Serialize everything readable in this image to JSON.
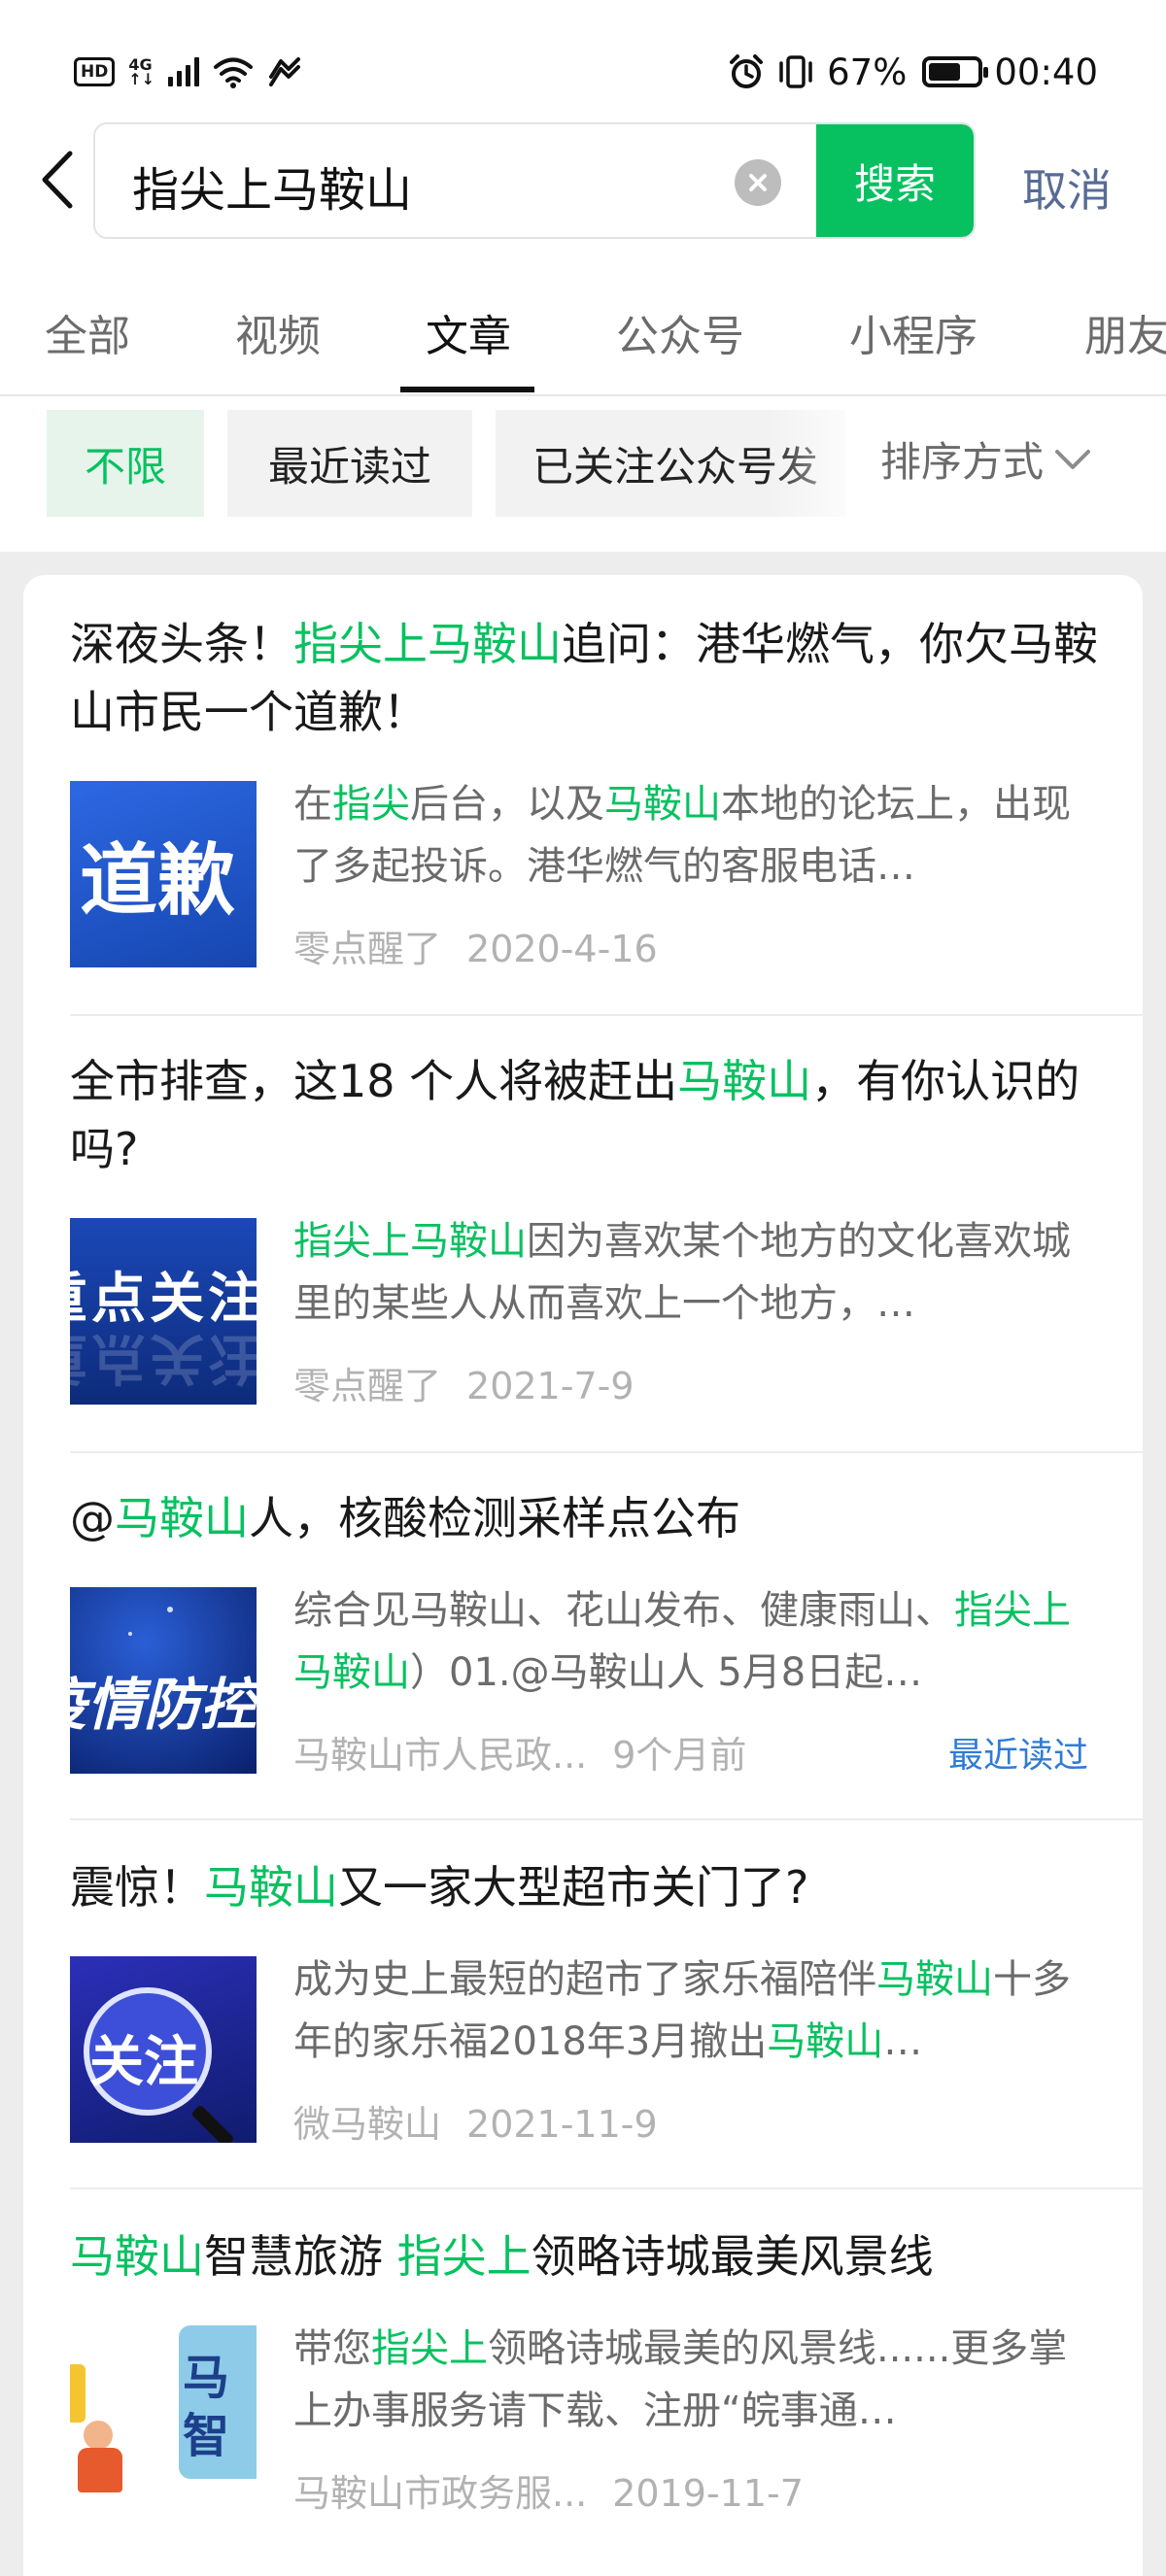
{
  "status_bar": {
    "hd": "HD",
    "network_top": "4G",
    "network_bottom": "↑↓",
    "battery_percent": "67%",
    "battery_level": 0.67,
    "time": "00:40"
  },
  "search": {
    "query": "指尖上马鞍山",
    "button_label": "搜索",
    "cancel_label": "取消"
  },
  "tabs": [
    {
      "label": "全部",
      "active": false
    },
    {
      "label": "视频",
      "active": false
    },
    {
      "label": "文章",
      "active": true
    },
    {
      "label": "公众号",
      "active": false
    },
    {
      "label": "小程序",
      "active": false
    },
    {
      "label": "朋友",
      "active": false
    }
  ],
  "filters": {
    "chips": [
      {
        "label": "不限",
        "active": true
      },
      {
        "label": "最近读过",
        "active": false
      },
      {
        "label": "已关注公众号发",
        "active": false
      }
    ],
    "sort_label": "排序方式"
  },
  "highlight_color": "#07c160",
  "results": [
    {
      "title": [
        "深夜头条！",
        "指尖上马鞍山",
        "追问：港华燃气，你欠马鞍山市民一个道歉！"
      ],
      "desc": [
        "在",
        "指尖",
        "后台，以及",
        "马鞍山",
        "本地的论坛上，出现了多起投诉。港华燃气的客服电话…"
      ],
      "thumb": "道歉",
      "source": "零点醒了",
      "date": "2020-4-16",
      "tag": ""
    },
    {
      "title": [
        "全市排查，这18 个人将被赶出",
        "马鞍山",
        "，有你认识的吗?"
      ],
      "desc": [
        "",
        "指尖上马鞍山",
        "因为喜欢某个地方的文化喜欢城里的某些人从而喜欢上一个地方，…"
      ],
      "thumb": "重点关注",
      "source": "零点醒了",
      "date": "2021-7-9",
      "tag": ""
    },
    {
      "title": [
        "@",
        "马鞍山",
        "人，核酸检测采样点公布"
      ],
      "desc": [
        "综合见马鞍山、花山发布、健康雨山、",
        "指尖上马鞍山",
        "）01.@马鞍山人 5月8日起…"
      ],
      "thumb": "疫情防控",
      "source": "马鞍山市人民政...",
      "date": "9个月前",
      "tag": "最近读过"
    },
    {
      "title": [
        "震惊！",
        "马鞍山",
        "又一家大型超市关门了?"
      ],
      "desc": [
        "成为史上最短的超市了家乐福陪伴",
        "马鞍山",
        "十多年的家乐福2018年3月撤出",
        "马鞍山",
        "…"
      ],
      "thumb": "关注",
      "source": "微马鞍山",
      "date": "2021-11-9",
      "tag": ""
    },
    {
      "title": [
        "",
        "马鞍山",
        "智慧旅游 ",
        "指尖上",
        "领略诗城最美风景线"
      ],
      "desc": [
        "带您",
        "指尖上",
        "领略诗城最美的风景线......更多掌上办事服务请下载、注册“皖事通…"
      ],
      "thumb": "马智",
      "source": "马鞍山市政务服...",
      "date": "2019-11-7",
      "tag": ""
    }
  ]
}
